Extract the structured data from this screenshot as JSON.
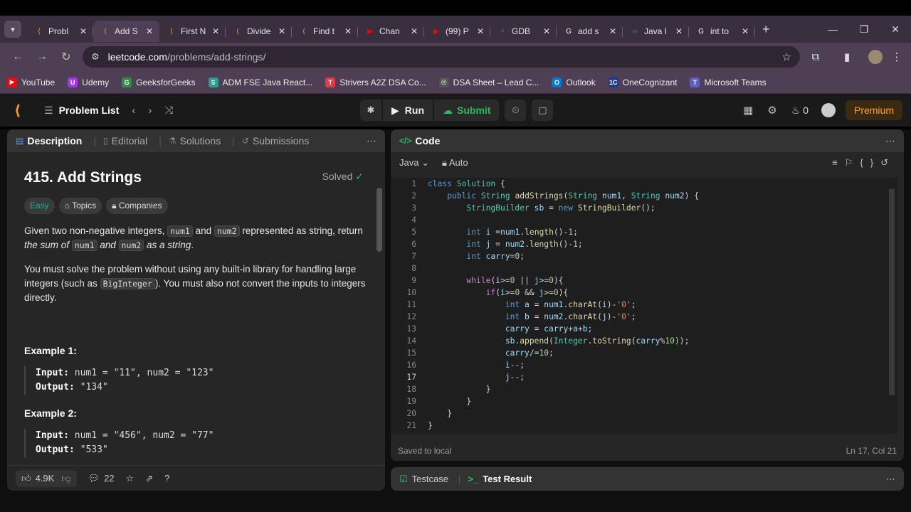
{
  "browser": {
    "tabs": [
      {
        "title": "Probl",
        "icon": "leetcode-icon",
        "color": "#ffa116",
        "glyph": "⟨"
      },
      {
        "title": "Add S",
        "icon": "leetcode-icon",
        "color": "#ffa116",
        "glyph": "⟨",
        "active": true
      },
      {
        "title": "First N",
        "icon": "leetcode-icon",
        "color": "#ffa116",
        "glyph": "⟨"
      },
      {
        "title": "Divide",
        "icon": "leetcode-icon",
        "color": "#ffa116",
        "glyph": "⟨"
      },
      {
        "title": "Find t",
        "icon": "leetcode-icon",
        "color": "#ffa116",
        "glyph": "⟨"
      },
      {
        "title": "Chan",
        "icon": "youtube-icon",
        "color": "#ff0000",
        "glyph": "▶"
      },
      {
        "title": "(99) P",
        "icon": "youtube-icon",
        "color": "#ff0000",
        "glyph": "▶"
      },
      {
        "title": "GDB",
        "icon": "gdb-icon",
        "color": "#7a4dff",
        "glyph": "⚡"
      },
      {
        "title": "add s",
        "icon": "google-icon",
        "color": "#ffffff",
        "glyph": "G"
      },
      {
        "title": "Java I",
        "icon": "gfg-icon",
        "color": "#2f8d46",
        "glyph": "∞"
      },
      {
        "title": "int to",
        "icon": "google-icon",
        "color": "#ffffff",
        "glyph": "G"
      }
    ],
    "url_host": "leetcode.com",
    "url_path": "/problems/add-strings/",
    "bookmarks": [
      {
        "label": "YouTube",
        "color": "#ff0000",
        "glyph": "▶"
      },
      {
        "label": "Udemy",
        "color": "#a435f0",
        "glyph": "U"
      },
      {
        "label": "GeeksforGeeks",
        "color": "#2f8d46",
        "glyph": "G"
      },
      {
        "label": "ADM FSE Java React...",
        "color": "#2a9d8f",
        "glyph": "S"
      },
      {
        "label": "Strivers A2Z DSA Co...",
        "color": "#e63946",
        "glyph": "T"
      },
      {
        "label": "DSA Sheet – Lead C...",
        "color": "#555555",
        "glyph": "◎"
      },
      {
        "label": "Outlook",
        "color": "#0078d4",
        "glyph": "O"
      },
      {
        "label": "OneCognizant",
        "color": "#1a3b8f",
        "glyph": "1C"
      },
      {
        "label": "Microsoft Teams",
        "color": "#5b5fc7",
        "glyph": "T"
      }
    ]
  },
  "leetcode": {
    "problem_list_label": "Problem List",
    "run_label": "Run",
    "submit_label": "Submit",
    "streak": "0",
    "premium_label": "Premium",
    "left_tabs": [
      {
        "label": "Description",
        "icon": "description-icon",
        "glyph": "▤"
      },
      {
        "label": "Editorial",
        "icon": "editorial-icon",
        "glyph": "▯"
      },
      {
        "label": "Solutions",
        "icon": "solutions-icon",
        "glyph": "⚗"
      },
      {
        "label": "Submissions",
        "icon": "submissions-icon",
        "glyph": "↺"
      }
    ],
    "problem": {
      "title": "415. Add Strings",
      "status": "Solved",
      "difficulty": "Easy",
      "topics_label": "Topics",
      "companies_label": "Companies",
      "p1_a": "Given two non-negative integers, ",
      "p1_num1": "num1",
      "p1_b": " and ",
      "p1_num2": "num2",
      "p1_c": " represented as string, return ",
      "p1_d": "the sum of ",
      "p1_e": " and ",
      "p1_f": " as a string",
      "p1_g": ".",
      "p2_a": "You must solve the problem without using any built-in library for handling large integers (such as ",
      "p2_code": "BigInteger",
      "p2_b": "). You must also not convert the inputs to integers directly.",
      "example1_title": "Example 1:",
      "example1_input_label": "Input:",
      "example1_input": " num1 = \"11\", num2 = \"123\"",
      "example1_output_label": "Output:",
      "example1_output": " \"134\"",
      "example2_title": "Example 2:",
      "example2_input_label": "Input:",
      "example2_input": " num1 = \"456\", num2 = \"77\"",
      "example2_output_label": "Output:",
      "example2_output": " \"533\""
    },
    "footer": {
      "likes": "4.9K",
      "comments": "22"
    },
    "code": {
      "tab_label": "Code",
      "language": "Java",
      "auto_label": "Auto",
      "saved": "Saved to local",
      "cursor": "Ln 17, Col 21",
      "current_line": 17
    },
    "bottom_tabs": {
      "testcase": "Testcase",
      "result": "Test Result"
    }
  }
}
